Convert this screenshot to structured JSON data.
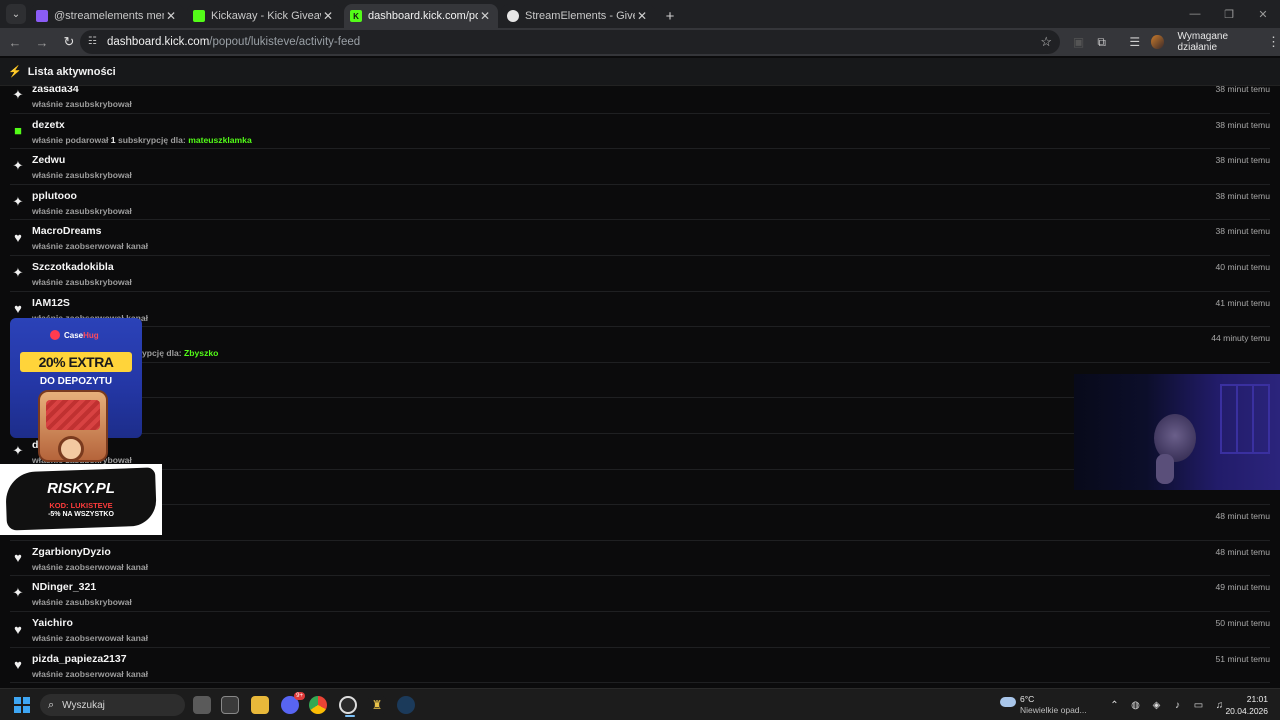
{
  "browser": {
    "tabs": [
      {
        "label": "@streamelements mentione",
        "favicon_color": "#8b5cf6",
        "active": false
      },
      {
        "label": "Kickaway - Kick Giveaway Tool",
        "favicon_color": "#53fc18",
        "active": false
      },
      {
        "label": "dashboard.kick.com/popout/lu",
        "favicon_color": "#53fc18",
        "active": true
      },
      {
        "label": "StreamElements - Giveaways",
        "favicon_color": "#e6e6e6",
        "active": false
      }
    ],
    "url_host": "dashboard.kick.com",
    "url_path": "/popout/lukisteve/activity-feed",
    "action_label": "Wymagane działanie"
  },
  "page": {
    "title": "Lista aktywności"
  },
  "feed": {
    "items": [
      {
        "icon": "sparkle-icon",
        "user": "zasada34",
        "desc": "właśnie zasubskrybował",
        "time": "38 minut temu"
      },
      {
        "icon": "gift-icon",
        "user": "dezetx",
        "desc_pre": "właśnie podarował ",
        "desc_num": "1",
        "desc_mid": " subskrypcję dla: ",
        "recipient": "mateuszklamka",
        "time": "38 minut temu"
      },
      {
        "icon": "sparkle-icon",
        "user": "Zedwu",
        "desc": "właśnie zasubskrybował",
        "time": "38 minut temu"
      },
      {
        "icon": "sparkle-icon",
        "user": "pplutooo",
        "desc": "właśnie zasubskrybował",
        "time": "38 minut temu"
      },
      {
        "icon": "heart-icon",
        "user": "MacroDreams",
        "desc": "właśnie zaobserwował kanał",
        "time": "38 minut temu"
      },
      {
        "icon": "sparkle-icon",
        "user": "Szczotkadokibla",
        "desc": "właśnie zasubskrybował",
        "time": "40 minut temu"
      },
      {
        "icon": "heart-icon",
        "user": "IAM12S",
        "desc": "właśnie zaobserwował kanał",
        "time": "41 minut temu"
      },
      {
        "icon": "gift-icon",
        "user": "",
        "desc_pre": "",
        "desc_num": "",
        "desc_mid": "ypcję dla: ",
        "recipient": "Zbyszko",
        "time": "44 minuty temu"
      },
      {
        "icon": "",
        "user": "",
        "desc": "",
        "time": ""
      },
      {
        "icon": "",
        "user": "",
        "desc": "",
        "time": ""
      },
      {
        "icon": "sparkle-icon",
        "user": "d",
        "desc": "właśnie zasubskrybował",
        "time": ""
      },
      {
        "icon": "",
        "user": "",
        "desc": "",
        "time": ""
      },
      {
        "icon": "",
        "user": "",
        "desc": "",
        "time": "48 minut temu"
      },
      {
        "icon": "heart-icon",
        "user": "ZgarbionyDyzio",
        "desc": "właśnie zaobserwował kanał",
        "time": "48 minut temu"
      },
      {
        "icon": "sparkle-icon",
        "user": "NDinger_321",
        "desc": "właśnie zasubskrybował",
        "time": "49 minut temu"
      },
      {
        "icon": "heart-icon",
        "user": "Yaichiro",
        "desc": "właśnie zaobserwował kanał",
        "time": "50 minut temu"
      },
      {
        "icon": "heart-icon",
        "user": "pizda_papieza2137",
        "desc": "właśnie zaobserwował kanał",
        "time": "51 minut temu"
      }
    ]
  },
  "overlays": {
    "case_brand": "Case",
    "case_brand_accent": "Hug",
    "case_headline": "20% EXTRA",
    "case_sub": "DO DEPOZYTU",
    "risky_logo": "RISKY.PL",
    "risky_code": "KOD: LUKISTEVE",
    "risky_discount": "-5% NA WSZYSTKO"
  },
  "taskbar": {
    "search_placeholder": "Wyszukaj",
    "discord_badge": "9+",
    "weather_temp": "6°C",
    "weather_cond": "Niewielkie opad...",
    "time": "21:01",
    "date": "20.04.2026"
  },
  "colors": {
    "kick_green": "#53fc18",
    "page_bg": "#0b0b0c"
  }
}
